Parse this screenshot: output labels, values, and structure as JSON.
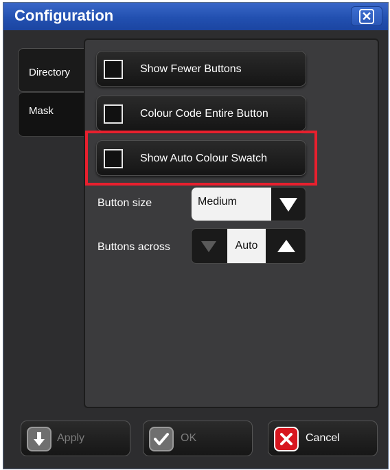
{
  "window": {
    "title": "Configuration",
    "close_icon": "close-x-icon"
  },
  "tabs": [
    {
      "label": "Directory",
      "active": true
    },
    {
      "label": "Mask",
      "active": false
    }
  ],
  "options": [
    {
      "label": "Show Fewer Buttons",
      "checked": false
    },
    {
      "label": "Colour Code Entire Button",
      "checked": false
    },
    {
      "label": "Show Auto Colour Swatch",
      "checked": false,
      "highlighted": true
    }
  ],
  "button_size": {
    "label": "Button size",
    "value": "Medium"
  },
  "buttons_across": {
    "label": "Buttons across",
    "value": "Auto"
  },
  "footer": {
    "apply": {
      "label": "Apply",
      "enabled": false,
      "icon": "download-arrow-icon"
    },
    "ok": {
      "label": "OK",
      "enabled": false,
      "icon": "checkmark-icon"
    },
    "cancel": {
      "label": "Cancel",
      "enabled": true,
      "icon": "cancel-x-icon"
    }
  },
  "colors": {
    "title_bar": "#2250b0",
    "highlight": "#e8202e",
    "cancel_icon": "#d7161f"
  }
}
